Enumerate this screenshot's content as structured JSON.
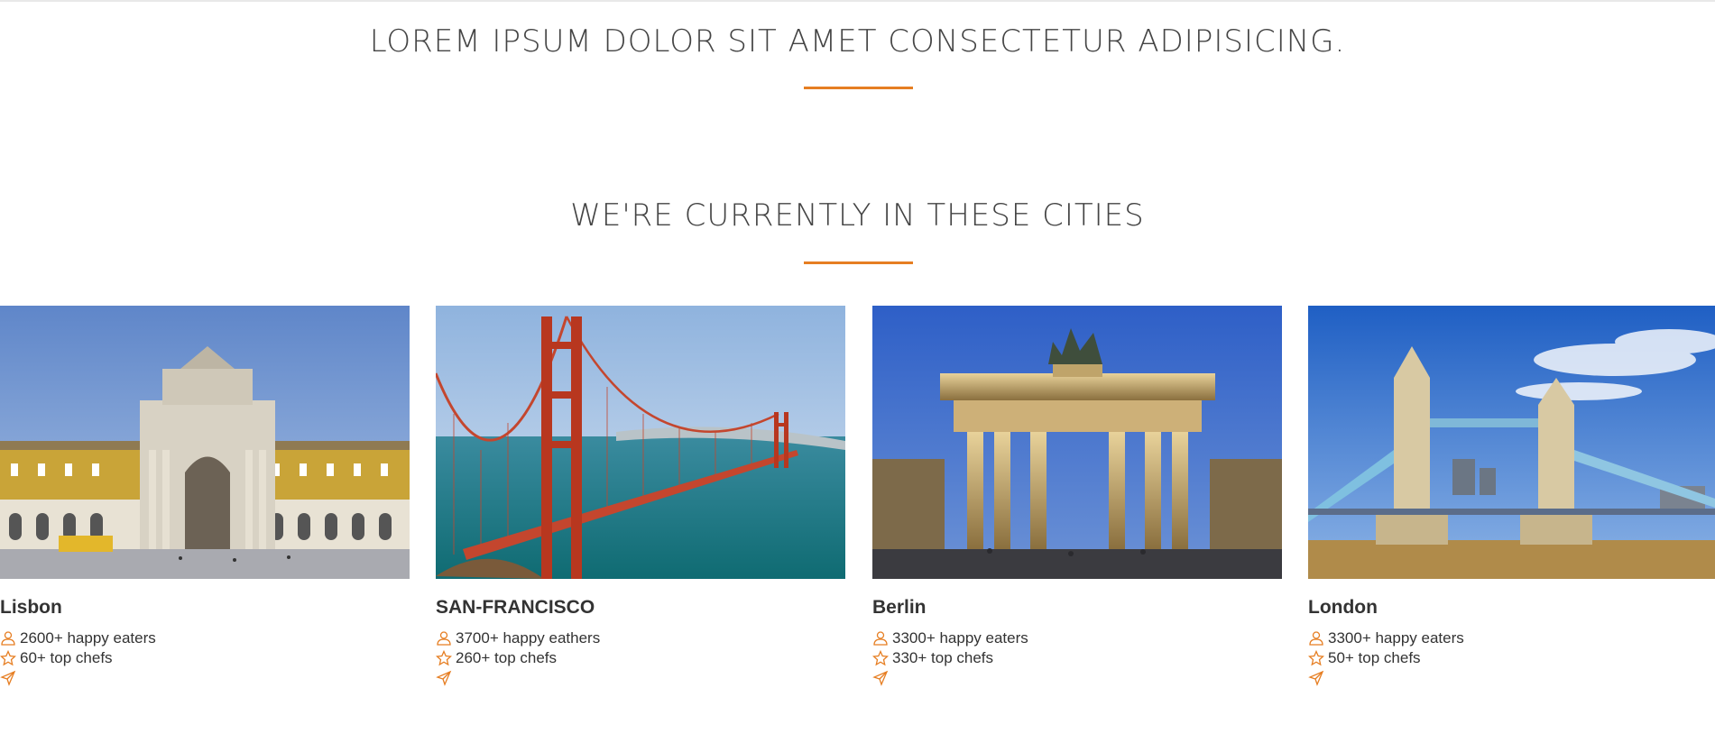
{
  "header": {
    "tagline": "LOREM IPSUM DOLOR SIT AMET CONSECTETUR ADIPISICING."
  },
  "cities_section": {
    "title": "WE'RE CURRENTLY IN THESE CITIES",
    "accent_color": "#e67e22",
    "icon_color": "#e67e22",
    "cities": [
      {
        "name": "Lisbon",
        "eaters": "2600+ happy eaters",
        "chefs": "60+ top chefs",
        "icons": [
          "person-icon",
          "star-icon",
          "send-icon"
        ]
      },
      {
        "name": "SAN-FRANCISCO",
        "eaters": "3700+ happy eathers",
        "chefs": "260+ top chefs",
        "icons": [
          "person-icon",
          "star-icon",
          "send-icon"
        ]
      },
      {
        "name": "Berlin",
        "eaters": "3300+ happy eaters",
        "chefs": "330+ top chefs",
        "icons": [
          "person-icon",
          "star-icon",
          "send-icon"
        ]
      },
      {
        "name": "London",
        "eaters": "3300+ happy eaters",
        "chefs": "50+ top chefs",
        "icons": [
          "person-icon",
          "star-icon",
          "send-icon"
        ]
      }
    ]
  }
}
